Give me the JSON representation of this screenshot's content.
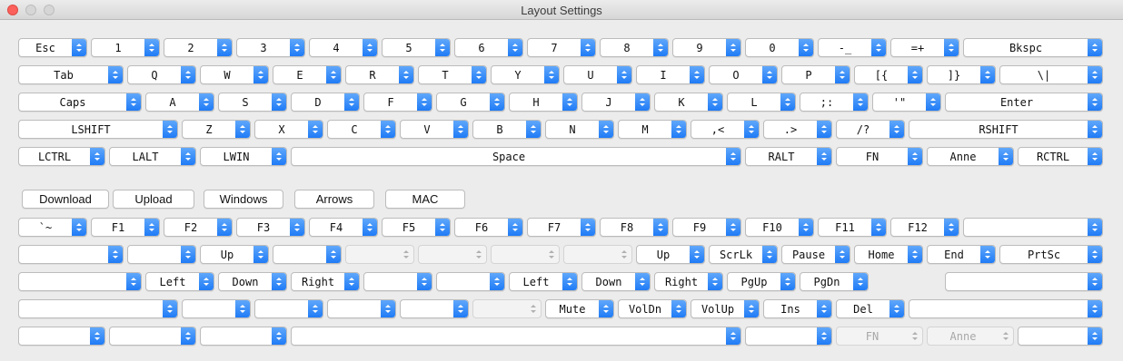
{
  "window": {
    "title": "Layout Settings"
  },
  "top_keys": [
    [
      "Esc",
      "1",
      "2",
      "3",
      "4",
      "5",
      "6",
      "7",
      "8",
      "9",
      "0",
      "-_",
      "=+",
      "Bkspc"
    ],
    [
      "Tab",
      "Q",
      "W",
      "E",
      "R",
      "T",
      "Y",
      "U",
      "I",
      "O",
      "P",
      "[{",
      "]}",
      "\\|"
    ],
    [
      "Caps",
      "A",
      "S",
      "D",
      "F",
      "G",
      "H",
      "J",
      "K",
      "L",
      ";:",
      "'\"",
      "Enter"
    ],
    [
      "LSHIFT",
      "Z",
      "X",
      "C",
      "V",
      "B",
      "N",
      "M",
      ",<",
      ".>",
      "/?",
      "RSHIFT"
    ],
    [
      "LCTRL",
      "LALT",
      "LWIN",
      "Space",
      "RALT",
      "FN",
      "Anne",
      "RCTRL"
    ]
  ],
  "buttons": [
    "Download",
    "Upload",
    "Windows",
    "Arrows",
    "MAC"
  ],
  "bottom_keys": [
    [
      "`~",
      "F1",
      "F2",
      "F3",
      "F4",
      "F5",
      "F6",
      "F7",
      "F8",
      "F9",
      "F10",
      "F11",
      "F12",
      ""
    ],
    [
      "",
      "",
      "Up",
      "",
      "",
      "",
      "",
      "",
      "Up",
      "ScrLk",
      "Pause",
      "Home",
      "End",
      "PrtSc"
    ],
    [
      "",
      "Left",
      "Down",
      "Right",
      "",
      "",
      "Left",
      "Down",
      "Right",
      "PgUp",
      "PgDn",
      ""
    ],
    [
      "",
      "",
      "",
      "",
      "",
      "",
      "Mute",
      "VolDn",
      "VolUp",
      "Ins",
      "Del",
      ""
    ],
    [
      "",
      "",
      "",
      "",
      "",
      "FN",
      "Anne",
      ""
    ]
  ],
  "bottom_disabled": [
    [],
    [
      4,
      5,
      6,
      7
    ],
    [],
    [
      5
    ],
    [
      5,
      6
    ]
  ]
}
